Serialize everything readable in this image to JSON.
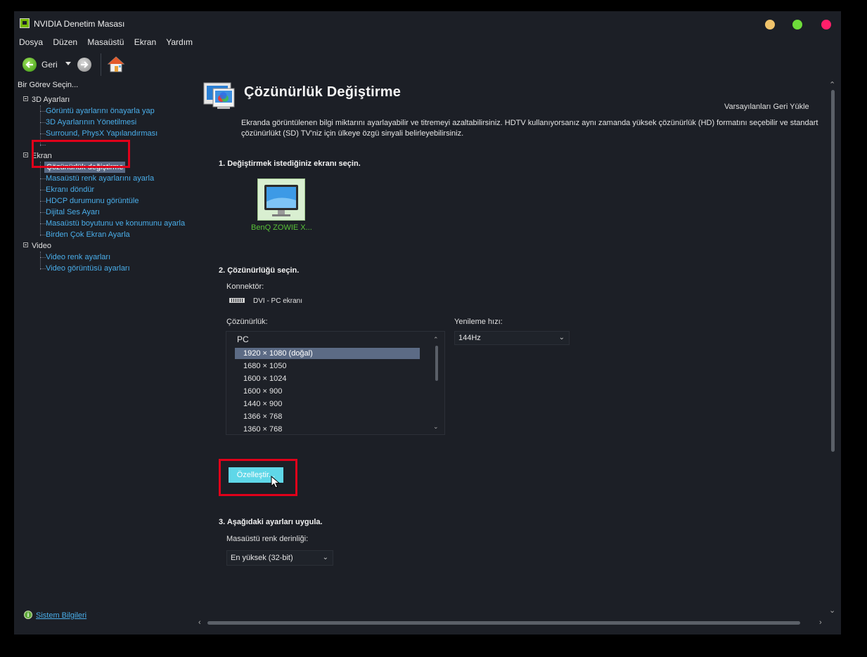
{
  "window": {
    "title": "NVIDIA Denetim Masası"
  },
  "menu": [
    "Dosya",
    "Düzen",
    "Masaüstü",
    "Ekran",
    "Yardım"
  ],
  "toolbar": {
    "back_label": "Geri"
  },
  "task_header": "Bir Görev Seçin...",
  "tree": {
    "cat_3d": "3D Ayarları",
    "item_3d_1": "Görüntü ayarlarını önayarla yap",
    "item_3d_2": "3D Ayarlarının Yönetilmesi",
    "item_3d_3": "Surround, PhysX Yapılandırması",
    "cat_display": "Ekran",
    "item_d_1": "Çözünürlük değiştirme",
    "item_d_2": "Masaüstü renk ayarlarını ayarla",
    "item_d_3": "Ekranı döndür",
    "item_d_4": "HDCP durumunu görüntüle",
    "item_d_5": "Dijital Ses Ayarı",
    "item_d_6": "Masaüstü boyutunu ve konumunu ayarla",
    "item_d_7": "Birden Çok Ekran Ayarla",
    "cat_video": "Video",
    "item_v_1": "Video renk ayarları",
    "item_v_2": "Video görüntüsü ayarları"
  },
  "system_info": "Sistem Bilgileri",
  "page": {
    "title": "Çözünürlük Değiştirme",
    "restore_defaults": "Varsayılanları Geri Yükle",
    "description": "Ekranda görüntülenen bilgi miktarını ayarlayabilir ve titremeyi azaltabilirsiniz. HDTV kullanıyorsanız aynı zamanda yüksek çözünürlük (HD) formatını seçebilir ve standart çözünürlükt (SD) TV'niz için ülkeye özgü sinyali belirleyebilirsiniz.",
    "step1": "1. Değiştirmek istediğiniz ekranı seçin.",
    "monitor_name": "BenQ ZOWIE X...",
    "step2": "2. Çözünürlüğü seçin.",
    "connector_label": "Konnektör:",
    "connector_value": "DVI - PC ekranı",
    "resolution_label": "Çözünürlük:",
    "refresh_label": "Yenileme hızı:",
    "refresh_value": "144Hz",
    "res_group": "PC",
    "resolutions": [
      "1920 × 1080 (doğal)",
      "1680 × 1050",
      "1600 × 1024",
      "1600 × 900",
      "1440 × 900",
      "1366 × 768",
      "1360 × 768"
    ],
    "customize_button": "Özelleştir...",
    "step3": "3. Aşağıdaki ayarları uygula.",
    "color_depth_label": "Masaüstü renk derinliği:",
    "color_depth_value": "En yüksek (32-bit)"
  },
  "colors": {
    "accent_green": "#76b900",
    "link": "#4aaeea",
    "highlight": "#e0001a",
    "button": "#5fd7e8"
  }
}
